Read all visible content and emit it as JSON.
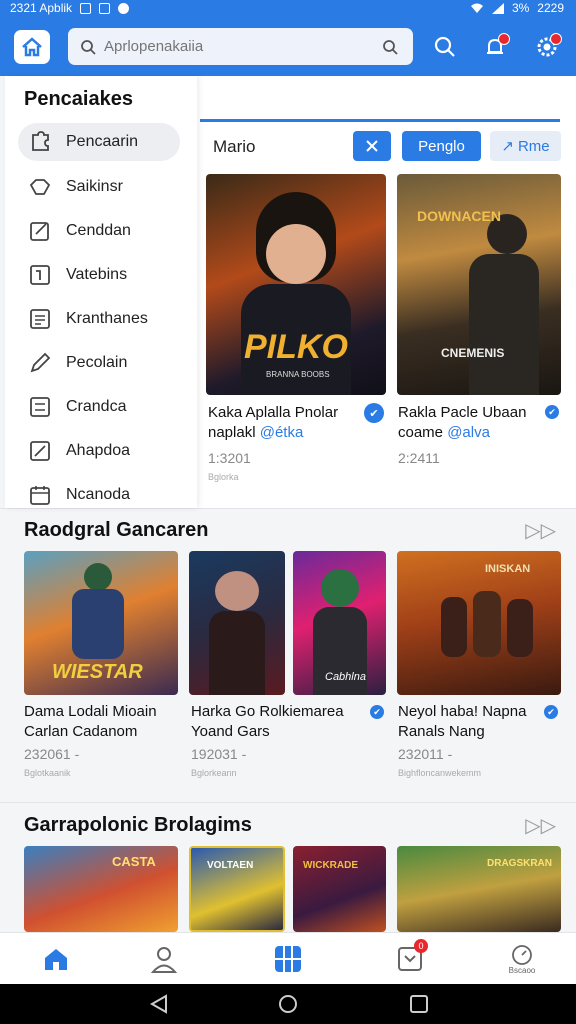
{
  "status_bar": {
    "time_left": "2321 Apblik",
    "battery": "3%",
    "time_right": "2229"
  },
  "header": {
    "search_placeholder": "Aprlopenakaiia"
  },
  "drawer": {
    "title": "Pencaiakes",
    "items": [
      {
        "label": "Pencaarin",
        "icon": "puzzle-icon"
      },
      {
        "label": "Saikinsr",
        "icon": "gamepad-icon"
      },
      {
        "label": "Cenddan",
        "icon": "edit-icon"
      },
      {
        "label": "Vatebins",
        "icon": "frame-icon"
      },
      {
        "label": "Kranthanes",
        "icon": "list-icon"
      },
      {
        "label": "Pecolain",
        "icon": "pen-icon"
      },
      {
        "label": "Crandca",
        "icon": "sliders-icon"
      },
      {
        "label": "Ahapdoa",
        "icon": "slash-box-icon"
      },
      {
        "label": "Ncanoda",
        "icon": "calendar-icon"
      }
    ]
  },
  "top_panel": {
    "label": "Mario",
    "btn_primary": "Penglo",
    "btn_secondary": "Rme",
    "cards": [
      {
        "title1": "Kaka Aplalla Pnolar",
        "title2a": "naplakl",
        "title2b": "@étka",
        "meta": "1:3201",
        "meta_small": "Bglorka",
        "art_text": "PILKO",
        "art_sub": "BRANNA BOOBS"
      },
      {
        "title1": "Rakla Pacle Ubaan",
        "title2a": "coame",
        "title2b": "@alva",
        "meta": "2:2411",
        "meta_small": "",
        "art_text": "DOWNACEN",
        "art_sub": "CNEMENIS"
      }
    ]
  },
  "section1": {
    "title": "Raodgral Gancaren",
    "cards": [
      {
        "title1": "Dama Lodali Mioain",
        "title2": "Carlan Cadanom",
        "meta": "232061 -",
        "meta_small": "Bglotkaanik",
        "art_text": "WIESTAR"
      },
      {
        "title1": "Harka Go Rolkiemarea",
        "title2": "Yoand Gars",
        "meta": "192031 -",
        "meta_small": "Bglorkeann",
        "art_text": ""
      },
      {
        "title1": "",
        "title2": "",
        "meta": "",
        "meta_small": "",
        "art_text": "Cabhlna"
      },
      {
        "title1": "Neyol haba! Napna",
        "title2": "Ranals Nang",
        "meta": "232011 -",
        "meta_small": "Bighfloncanwekemm",
        "art_text": "INISKAN"
      }
    ]
  },
  "section2": {
    "title": "Garrapolonic Brolagims",
    "arts": [
      "CASTA",
      "VOLTAEN",
      "WICKRADE",
      "DRAGSKRAN"
    ]
  },
  "bottom_nav": {
    "badge": "0",
    "profile_label": "Bscaoo"
  },
  "colors": {
    "brand": "#2a7be4",
    "badge": "#e8282d"
  }
}
